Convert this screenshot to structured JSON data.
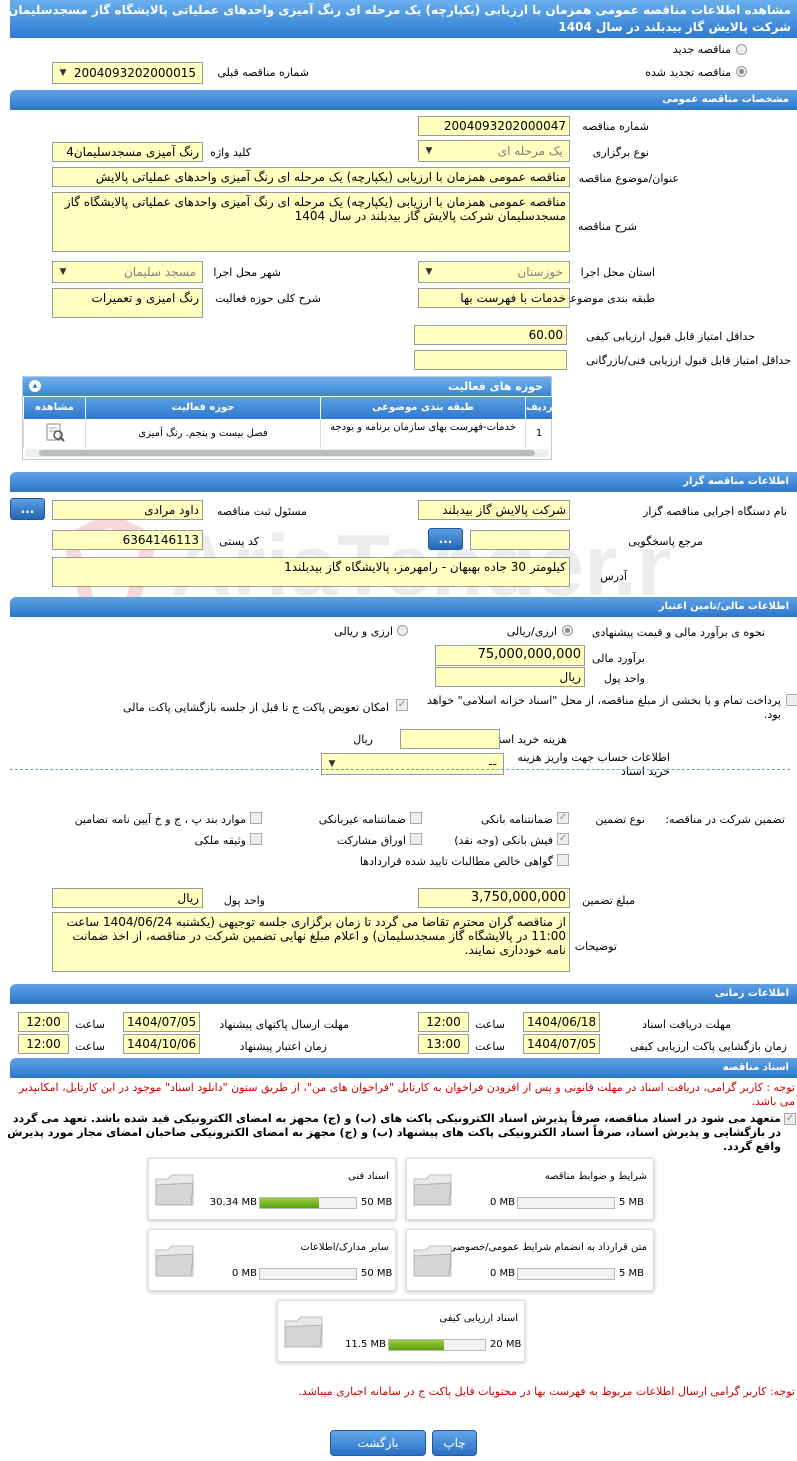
{
  "header": {
    "title_line1": "مشاهده اطلاعات مناقصه عمومی همزمان با ارزیابی (یکپارچه) یک مرحله ای رنگ آمیزی واحدهای عملیاتی پالایشگاه گاز مسجدسلیمان",
    "title_line2": "شرکت پالایش گاز بیدبلند در سال 1404"
  },
  "top": {
    "new_tender": "مناقصه جدید",
    "renewed_tender": "مناقصه تجدید شده",
    "prev_tender_label": "شماره مناقصه قبلی",
    "prev_tender_value": "2004093202000015"
  },
  "general": {
    "section_title": "مشخصات مناقصه عمومی",
    "tender_number_label": "شماره مناقصه",
    "tender_number": "2004093202000047",
    "holding_type_label": "نوع برگزاری",
    "holding_type": "یک مرحله ای",
    "keyword_label": "کلید واژه",
    "keyword": "رنگ آمیزی مسجدسلیمان4",
    "subject_label": "عنوان/موضوع مناقصه",
    "subject": "مناقصه عمومی همزمان با ارزیابی (یکپارچه) یک مرحله ای رنگ آمیزی واحدهای عملیاتی پالایش",
    "desc_label": "شرح مناقصه",
    "desc": "مناقصه عمومی همزمان با ارزیابی (یکپارچه) یک مرحله ای رنگ آمیزی واحدهای عملیاتی پالایشگاه گاز مسجدسلیمان شرکت پالایش گاز بیدبلند در سال 1404",
    "province_label": "استان محل اجرا",
    "province": "خوزستان",
    "city_label": "شهر محل اجرا",
    "city": "مسجد سلیمان",
    "category_label": "طبقه بندی موضوعی",
    "category": "خدمات با فهرست بها",
    "activity_desc_label": "شرح کلی حوزه فعالیت",
    "activity_desc": "رنگ امیزی و تعمیرات",
    "min_quality_label": "حداقل امتیاز قابل قبول ارزیابی کیفی",
    "min_quality": "60.00",
    "min_tech_label": "حداقل امتیاز قابل قبول ارزیابی فنی/بازرگانی",
    "min_tech": ""
  },
  "activity_grid": {
    "title": "حوزه های فعالیت",
    "columns": [
      "ردیف",
      "طبقه بندی موضوعی",
      "حوزه فعالیت",
      "مشاهده"
    ],
    "rows": [
      {
        "index": "1",
        "category": "خدمات-فهرست بهای سازمان برنامه و بودجه",
        "field": "فصل بیست و پنجم. رنگ آمیزی"
      }
    ]
  },
  "organizer": {
    "section_title": "اطلاعات مناقصه گزار",
    "org_label": "نام دستگاه اجرایی مناقصه گزار",
    "org": "شرکت پالایش گاز بیدبلند",
    "responsible_label": "مسئول ثبت مناقصه",
    "responsible": "داود مرادی",
    "ref_label": "مرجع پاسخگویی",
    "ref": "",
    "postal_label": "کد پستی",
    "postal": "6364146113",
    "address_label": "آدرس",
    "address": "کیلومتر 30 جاده بهبهان - رامهرمز، پالایشگاه گاز بیدبلند1",
    "btn": "..."
  },
  "finance": {
    "section_title": "اطلاعات مالی/تامین اعتبار",
    "estimate_label": "نحوه ی برآورد مالی و قیمت پیشنهادی",
    "opt_rial": "ارزی/ریالی",
    "opt_fx_rial": "ارزی و ریالی",
    "estimate_amount_label": "برآورد مالی",
    "estimate_amount": "75,000,000,000",
    "currency_label": "واحد پول",
    "currency": "ریال",
    "treasury_text": "پرداخت تمام و یا بخشی از مبلغ مناقصه، از محل \"اسناد خزانه اسلامی\" خواهد بود.",
    "swap_text": "امکان تعویض پاکت ج تا قبل از جلسه بازگشایی پاکت مالی",
    "doc_cost_label": "هزینه خرید اسناد",
    "doc_cost": "",
    "doc_cost_unit": "ریال",
    "account_label": "اطلاعات حساب جهت واریز هزینه خرید اسناد",
    "account": "--"
  },
  "guarantee": {
    "title": "تضمین شرکت در مناقصه:",
    "type_label": "نوع تضمین",
    "opts": {
      "bank_guarantee": "ضمانتنامه بانکی",
      "nonbank_guarantee": "ضمانتنامه غیربانکی",
      "clause_items": "موارد بند پ ، ج و خ آیین نامه تضامین",
      "bank_receipt": "فیش بانکی (وجه نقد)",
      "bonds": "اوراق مشارکت",
      "property": "وثیقه ملکی",
      "net_claims": "گواهی خالص مطالبات تایید شده قراردادها"
    },
    "amount_label": "مبلغ تضمین",
    "amount": "3,750,000,000",
    "currency_label": "واحد پول",
    "currency": "ریال",
    "notes_label": "توضیحات",
    "notes": "از مناقصه گران محترم تقاضا می گردد تا زمان برگزاری جلسه توجیهی (یکشنبه 1404/06/24 ساعت 11:00 در پالایشگاه گاز مسجدسلیمان) و اعلام مبلغ نهایی تضمین شرکت در مناقصه، از اخذ ضمانت نامه خودداری نمایند."
  },
  "timing": {
    "section_title": "اطلاعات زمانی",
    "doc_deadline_label": "مهلت دریافت اسناد",
    "doc_deadline_date": "1404/06/18",
    "doc_deadline_time": "12:00",
    "send_deadline_label": "مهلت ارسال پاکتهای پیشنهاد",
    "send_deadline_date": "1404/07/05",
    "send_deadline_time": "12:00",
    "open_label": "زمان بازگشایی پاکت ارزیابی کیفی",
    "open_date": "1404/07/05",
    "open_time": "13:00",
    "validity_label": "زمان اعتبار پیشنهاد",
    "validity_date": "1404/10/06",
    "validity_time": "12:00",
    "time_label": "ساعت"
  },
  "docs": {
    "section_title": "اسناد مناقصه",
    "note1": "توجه : کاربر گرامی، دریافت اسناد در مهلت قانونی و پس از افزودن فراخوان به کارتابل \"فراخوان های من\"، از طریق ستون \"دانلود اسناد\" موجود در این کارتابل، امکانپذیر می باشد.",
    "commit": "متعهد می شود در اسناد مناقصه، صرفاً پذیرش اسناد الکترونیکی پاکت های (ب) و (ج) مجهز به امضای الکترونیکی قید شده باشد. تعهد می گردد در بازگشایی و پذیرش اسناد، صرفاً اسناد الکترونیکی پاکت های پیشنهاد (ب) و (ج) مجهز به امضای الکترونیکی صاحبان امضای مجاز مورد پذیرش واقع گردد.",
    "boxes": [
      {
        "title": "شرایط و ضوابط مناقصه",
        "max": "5 MB",
        "cur": "0 MB",
        "fill": 0
      },
      {
        "title": "اسناد فنی",
        "max": "50 MB",
        "cur": "30.34 MB",
        "fill": 0.61
      },
      {
        "title": "متن قرارداد به انضمام شرایط عمومی/خصوصی",
        "max": "5 MB",
        "cur": "0 MB",
        "fill": 0
      },
      {
        "title": "سایر مدارک/اطلاعات",
        "max": "50 MB",
        "cur": "0 MB",
        "fill": 0
      },
      {
        "title": "اسناد ارزیابی کیفی",
        "max": "20 MB",
        "cur": "11.5 MB",
        "fill": 0.575
      }
    ],
    "note2": "توجه: کاربر گرامی ارسال اطلاعات مربوط به فهرست بها در محتویات فایل پاکت ج در سامانه اجباری میباشد."
  },
  "footer": {
    "print": "چاپ",
    "back": "بازگشت"
  },
  "watermark": "AriaTender.net"
}
